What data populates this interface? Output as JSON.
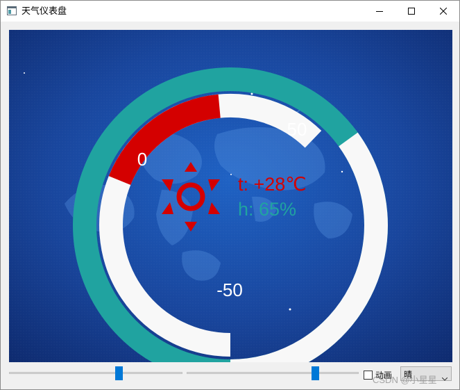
{
  "window": {
    "title": "天气仪表盘",
    "minimize_icon": "minimize-icon",
    "maximize_icon": "maximize-icon",
    "close_icon": "close-icon"
  },
  "gauge": {
    "temperature_text": "t: +28℃",
    "humidity_text": "h: 65%",
    "temperature_value": 28,
    "humidity_value": 65,
    "scale_labels": {
      "zero": "0",
      "fifty": "50",
      "minus_fifty": "-50"
    },
    "weather_icon": "sun-icon",
    "colors": {
      "temperature": "#d40000",
      "humidity": "#20a3a0",
      "track": "#f8f8f8",
      "background": "#1a4aa6"
    }
  },
  "controls": {
    "temperature_slider_level": 0.64,
    "humidity_slider_level": 0.76,
    "animation_checkbox_label": "动画",
    "animation_checked": false,
    "weather_combo_value": "晴"
  },
  "watermark": "CSDN @小星星"
}
